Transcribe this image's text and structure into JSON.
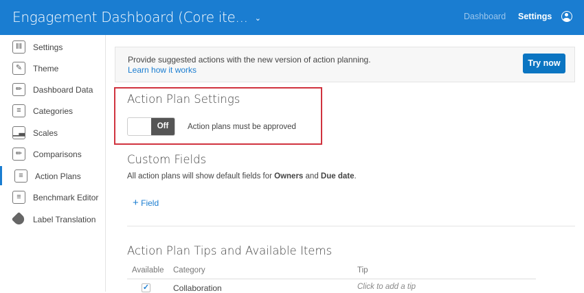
{
  "header": {
    "title": "Engagement Dashboard (Core ite...",
    "nav": [
      "Dashboard",
      "Settings"
    ]
  },
  "sidebar": {
    "items": [
      {
        "label": "Settings",
        "icon": "sliders-icon"
      },
      {
        "label": "Theme",
        "icon": "brush-icon"
      },
      {
        "label": "Dashboard Data",
        "icon": "pencil-icon"
      },
      {
        "label": "Categories",
        "icon": "list-icon"
      },
      {
        "label": "Scales",
        "icon": "bar-chart-icon"
      },
      {
        "label": "Comparisons",
        "icon": "pencil-icon"
      },
      {
        "label": "Action Plans",
        "icon": "clipboard-icon",
        "active": true
      },
      {
        "label": "Benchmark Editor",
        "icon": "list-icon"
      },
      {
        "label": "Label Translation",
        "icon": "tag-icon"
      }
    ]
  },
  "banner": {
    "text": "Provide suggested actions with the new version of action planning.",
    "link": "Learn how it works",
    "button": "Try now"
  },
  "action_plan_settings": {
    "title": "Action Plan Settings",
    "toggle": "Off",
    "toggle_label": "Action plans must be approved"
  },
  "custom_fields": {
    "title": "Custom Fields",
    "desc_pre": "All action plans will show default fields for ",
    "owners": "Owners",
    "and": " and ",
    "due": "Due date",
    "period": ".",
    "add": "Field"
  },
  "tips": {
    "title": "Action Plan Tips and Available Items",
    "columns": [
      "Available",
      "Category",
      "Tip"
    ],
    "rows": [
      {
        "available": true,
        "category": "Collaboration",
        "tip": "Click to add a tip"
      }
    ]
  }
}
